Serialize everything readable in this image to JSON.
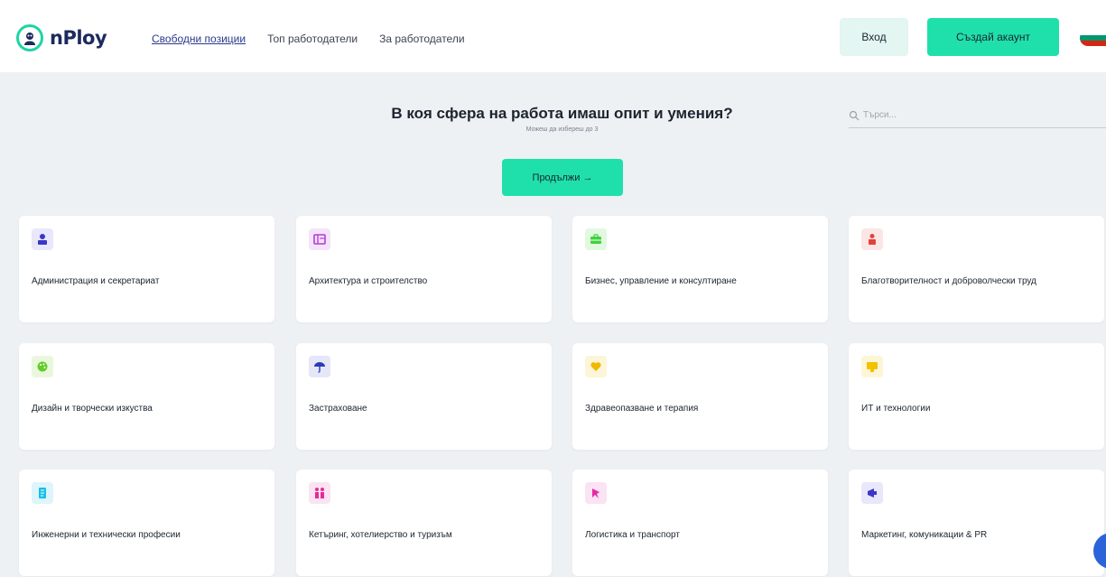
{
  "header": {
    "logo_text": "nPloy",
    "nav": [
      {
        "label": "Свободни позиции",
        "active": true
      },
      {
        "label": "Топ работодатели",
        "active": false
      },
      {
        "label": "За работодатели",
        "active": false
      }
    ],
    "login_label": "Вход",
    "register_label": "Създай акаунт",
    "flag_colors": [
      "#ffffff",
      "#00966e",
      "#d62612"
    ]
  },
  "hero": {
    "title": "В коя сфера на работа имаш опит и умения?",
    "subtitle": "Можеш да избереш до 3",
    "continue_label": "Продължи →"
  },
  "search": {
    "placeholder": "Търси..."
  },
  "categories": [
    {
      "label": "Администрация и секретариат",
      "icon": "admin-person-icon",
      "color": "#3b36c9",
      "bg": "#e8e7fb"
    },
    {
      "label": "Архитектура и строителство",
      "icon": "blueprint-icon",
      "color": "#b63ad8",
      "bg": "#f3e4fb"
    },
    {
      "label": "Бизнес, управление и консултиране",
      "icon": "briefcase-icon",
      "color": "#3fd13a",
      "bg": "#e2f8e1"
    },
    {
      "label": "Благотворителност и доброволчески труд",
      "icon": "charity-person-icon",
      "color": "#e0423b",
      "bg": "#fbe6e5"
    },
    {
      "label": "Дизайн и творчески изкуства",
      "icon": "palette-icon",
      "color": "#63cc2a",
      "bg": "#e9f8dd"
    },
    {
      "label": "Застраховане",
      "icon": "umbrella-icon",
      "color": "#2a3ab8",
      "bg": "#e5e7f8"
    },
    {
      "label": "Здравеопазване и терапия",
      "icon": "heart-icon",
      "color": "#f0b800",
      "bg": "#fdf5d8"
    },
    {
      "label": "ИТ и технологии",
      "icon": "monitor-icon",
      "color": "#f2c200",
      "bg": "#fdf6d6"
    },
    {
      "label": "Инженерни и технически професии",
      "icon": "document-gear-icon",
      "color": "#19bfe6",
      "bg": "#ddf5fb"
    },
    {
      "label": "Кетъринг, хотелиерство и туризъм",
      "icon": "waiters-icon",
      "color": "#e62a9a",
      "bg": "#fbe3f1"
    },
    {
      "label": "Логистика и транспорт",
      "icon": "truck-icon",
      "color": "#e32aa8",
      "bg": "#fbe3f3"
    },
    {
      "label": "Маркетинг, комуникации & PR",
      "icon": "megaphone-icon",
      "color": "#3b36c9",
      "bg": "#e8e7fb"
    }
  ]
}
